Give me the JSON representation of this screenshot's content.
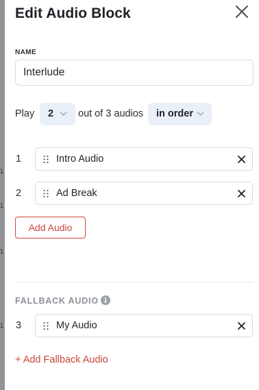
{
  "dialog": {
    "title": "Edit Audio Block",
    "name_label": "NAME",
    "name_value": "Interlude"
  },
  "play": {
    "prefix": "Play",
    "count": "2",
    "middle": "out of 3 audios",
    "order": "in order"
  },
  "audios": [
    {
      "index": "1",
      "name": "Intro Audio"
    },
    {
      "index": "2",
      "name": "Ad Break"
    }
  ],
  "add_audio_label": "Add Audio",
  "fallback": {
    "label": "FALLBACK AUDIO",
    "items": [
      {
        "index": "3",
        "name": "My Audio"
      }
    ],
    "add_label": "+ Add Fallback Audio"
  },
  "colors": {
    "accent": "#c8463a",
    "pill_bg": "#eaf0f7",
    "border": "#d9dbde"
  }
}
